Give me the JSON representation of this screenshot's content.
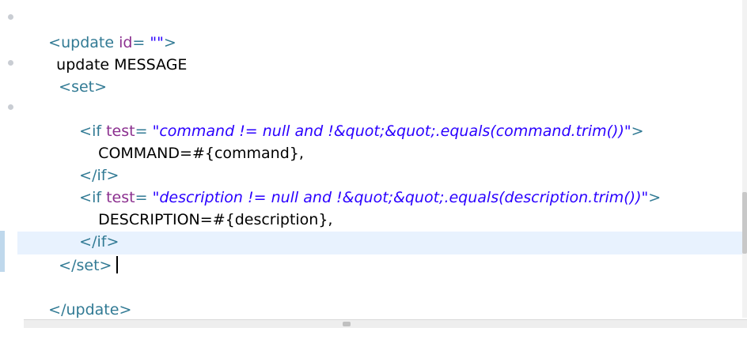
{
  "lines": [
    {
      "tag_open": "<update ",
      "attr": "id",
      "eq": "= ",
      "value": "\"\"",
      "tag_close": ">"
    },
    {
      "text": "update MESSAGE"
    },
    {
      "tag": "<set>"
    },
    {
      "tag_open": "<if ",
      "attr": "test",
      "eq": "= ",
      "value": "\"command != null and !&quot;&quot;.equals(command.trim())\"",
      "tag_close": ">"
    },
    {
      "text": "COMMAND=#{command},"
    },
    {
      "tag": "</if>"
    },
    {
      "tag_open": "<if ",
      "attr": "test",
      "eq": "= ",
      "value": "\"description != null and !&quot;&quot;.equals(description.trim())\"",
      "tag_close": ">"
    },
    {
      "text": "DESCRIPTION=#{description},"
    },
    {
      "tag": "</if>"
    },
    {
      "tag": "</set>"
    },
    {
      "tag": "</update>"
    }
  ],
  "colors": {
    "tag": "#317a94",
    "attribute": "#8b2f8f",
    "attribute_value": "#2a00ff",
    "text": "#000000",
    "current_line": "#e8f2fe"
  }
}
